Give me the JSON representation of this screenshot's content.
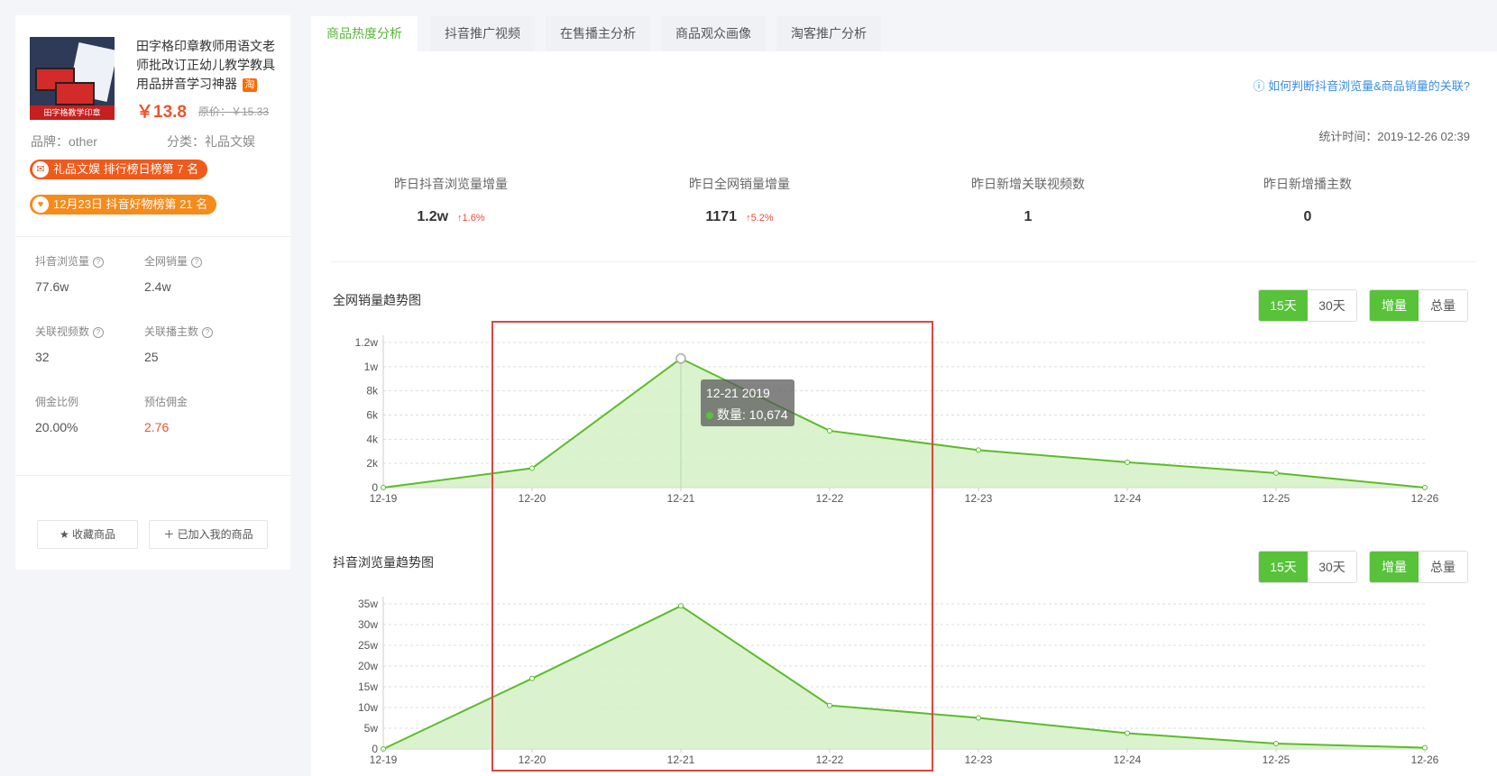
{
  "product": {
    "image_caption": "田字格教学印章",
    "title": "田字格印章教师用语文老师批改订正幼儿教学教具用品拼音学习神器",
    "platform_icon": "淘",
    "price": "￥13.8",
    "original_price": "原价：￥15.33",
    "brand": "品牌：other",
    "category": "分类：礼品文娱",
    "badges": [
      {
        "icon": "bag-icon",
        "text": "礼品文娱 排行榜日榜第 7 名"
      },
      {
        "icon": "heart-icon",
        "text": "12月23日 抖音好物榜第 21 名"
      }
    ],
    "stats": [
      {
        "label": "抖音浏览量",
        "value": "77.6w",
        "help": true
      },
      {
        "label": "全网销量",
        "value": "2.4w",
        "help": true
      },
      {
        "label": "关联视频数",
        "value": "32",
        "help": true
      },
      {
        "label": "关联播主数",
        "value": "25",
        "help": true
      },
      {
        "label": "佣金比例",
        "value": "20.00%",
        "help": false
      },
      {
        "label": "预估佣金",
        "value": "2.76",
        "help": false
      }
    ],
    "fav_button": "收藏商品",
    "add_button": "已加入我的商品"
  },
  "tabs": [
    "商品热度分析",
    "抖音推广视频",
    "在售播主分析",
    "商品观众画像",
    "淘客推广分析"
  ],
  "help_link": "如何判断抖音浏览量&商品销量的关联?",
  "stat_time": "统计时间：2019-12-26 02:39",
  "kpis": [
    {
      "label": "昨日抖音浏览量增量",
      "value": "1.2w",
      "change": "↑1.6%"
    },
    {
      "label": "昨日全网销量增量",
      "value": "1171",
      "change": "↑5.2%"
    },
    {
      "label": "昨日新增关联视频数",
      "value": "1",
      "change": ""
    },
    {
      "label": "昨日新增播主数",
      "value": "0",
      "change": ""
    }
  ],
  "controls": {
    "range_15": "15天",
    "range_30": "30天",
    "mode_inc": "增量",
    "mode_total": "总量"
  },
  "tooltip": {
    "date": "12-21 2019",
    "label": "数量: 10,674"
  },
  "colors": {
    "accent": "#57c23a",
    "line": "#5dbb2c",
    "fill": "#d3f0c5",
    "highlight": "#d9473f"
  },
  "chart_data": [
    {
      "type": "area",
      "title": "全网销量趋势图",
      "x": [
        "12-19",
        "12-20",
        "12-21",
        "12-22",
        "12-23",
        "12-24",
        "12-25",
        "12-26"
      ],
      "values": [
        0,
        1600,
        10674,
        4700,
        3100,
        2100,
        1200,
        0
      ],
      "ylim": [
        0,
        12000
      ],
      "yticks": [
        "0",
        "2k",
        "4k",
        "6k",
        "8k",
        "1w",
        "1.2w"
      ],
      "ytick_values": [
        0,
        2000,
        4000,
        6000,
        8000,
        10000,
        12000
      ],
      "grid": true
    },
    {
      "type": "area",
      "title": "抖音浏览量趋势图",
      "x": [
        "12-19",
        "12-20",
        "12-21",
        "12-22",
        "12-23",
        "12-24",
        "12-25",
        "12-26"
      ],
      "values": [
        0,
        170000,
        345000,
        105000,
        75000,
        38000,
        13000,
        3000
      ],
      "ylim": [
        0,
        350000
      ],
      "yticks": [
        "0",
        "5w",
        "10w",
        "15w",
        "20w",
        "25w",
        "30w",
        "35w"
      ],
      "ytick_values": [
        0,
        50000,
        100000,
        150000,
        200000,
        250000,
        300000,
        350000
      ],
      "grid": true
    }
  ]
}
